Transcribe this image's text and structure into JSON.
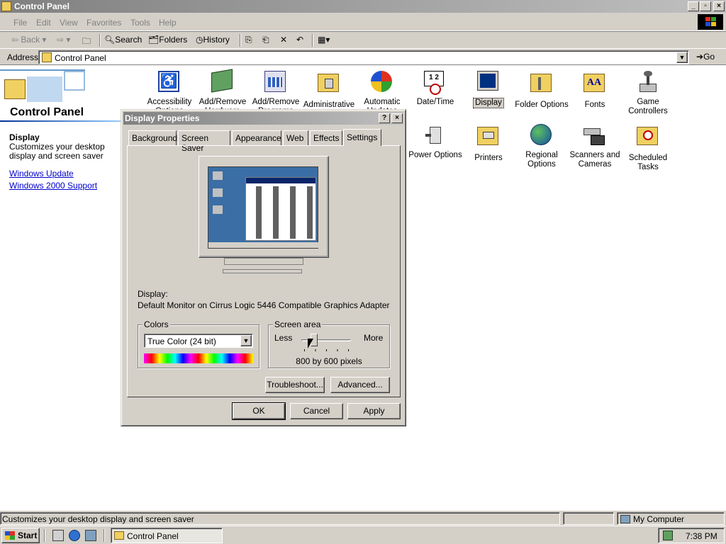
{
  "window": {
    "title": "Control Panel"
  },
  "menu": [
    "File",
    "Edit",
    "View",
    "Favorites",
    "Tools",
    "Help"
  ],
  "toolbar": {
    "back": "Back",
    "search": "Search",
    "folders": "Folders",
    "history": "History"
  },
  "address": {
    "label": "Address",
    "value": "Control Panel",
    "go": "Go"
  },
  "left_panel": {
    "title": "Control Panel",
    "selected_name": "Display",
    "selected_desc": "Customizes your desktop display and screen saver",
    "links": [
      "Windows Update",
      "Windows 2000 Support"
    ]
  },
  "icons": [
    {
      "label": "Accessibility Options"
    },
    {
      "label": "Add/Remove Hardware"
    },
    {
      "label": "Add/Remove Programs"
    },
    {
      "label": "Administrative Tools"
    },
    {
      "label": "Automatic Updates"
    },
    {
      "label": "Date/Time"
    },
    {
      "label": "Display"
    },
    {
      "label": "Folder Options"
    },
    {
      "label": "Fonts"
    },
    {
      "label": "Game Controllers"
    },
    {
      "label": "Power Options"
    },
    {
      "label": "Printers"
    },
    {
      "label": "Regional Options"
    },
    {
      "label": "Scanners and Cameras"
    },
    {
      "label": "Scheduled Tasks"
    }
  ],
  "dialog": {
    "title": "Display Properties",
    "tabs": [
      "Background",
      "Screen Saver",
      "Appearance",
      "Web",
      "Effects",
      "Settings"
    ],
    "selected_tab": "Settings",
    "display_label": "Display:",
    "display_value": "Default Monitor on Cirrus Logic 5446 Compatible Graphics Adapter",
    "colors_label": "Colors",
    "colors_value": "True Color (24 bit)",
    "screen_area_label": "Screen area",
    "less": "Less",
    "more": "More",
    "resolution": "800 by 600 pixels",
    "slider_position": 0.25,
    "troubleshoot": "Troubleshoot...",
    "advanced": "Advanced...",
    "ok": "OK",
    "cancel": "Cancel",
    "apply": "Apply"
  },
  "status": {
    "left": "Customizes your desktop display and screen saver",
    "right": "My Computer"
  },
  "taskbar": {
    "start": "Start",
    "task": "Control Panel",
    "clock": "7:38 PM"
  }
}
